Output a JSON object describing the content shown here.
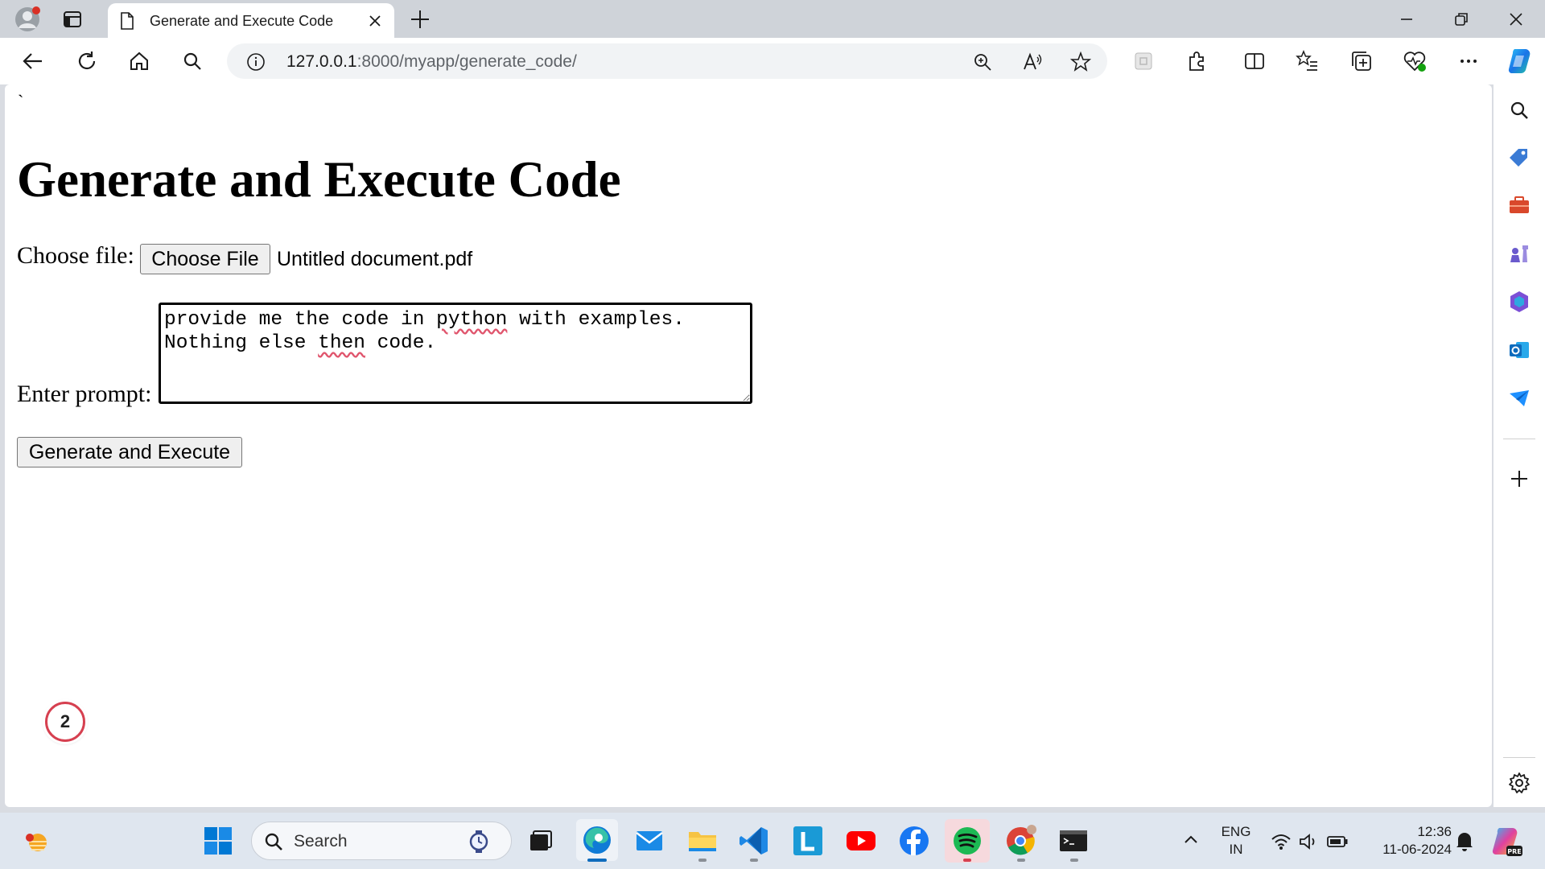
{
  "browser": {
    "tab": {
      "title": "Generate and Execute Code"
    },
    "address": {
      "host": "127.0.0.1",
      "path": ":8000/myapp/generate_code/"
    }
  },
  "page": {
    "stray_char": "`",
    "title": "Generate and Execute Code",
    "file_label": "Choose file:",
    "choose_button": "Choose File",
    "file_name": "Untitled document.pdf",
    "prompt_label": "Enter prompt:",
    "prompt_segments": {
      "a": "provide me the code in ",
      "b": "python",
      "c": " with examples. Nothing else ",
      "d": "then",
      "e": " code."
    },
    "submit_button": "Generate and Execute"
  },
  "notification": {
    "count": "2"
  },
  "taskbar": {
    "search_placeholder": "Search",
    "lang_top": "ENG",
    "lang_bottom": "IN",
    "time": "12:36",
    "date": "11-06-2024"
  },
  "colors": {
    "accent": "#0f6cbd",
    "spell_underline": "#e0556d",
    "youtube": "#ff0000",
    "spotify": "#1db954",
    "facebook": "#1877f2"
  }
}
